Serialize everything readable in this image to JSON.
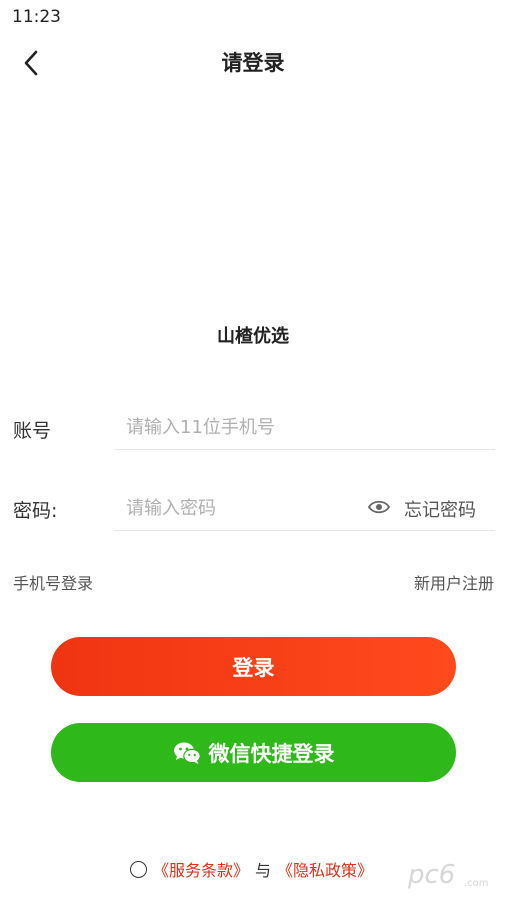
{
  "status_bar": {
    "time": "11:23"
  },
  "header": {
    "title": "请登录"
  },
  "app": {
    "name": "山楂优选"
  },
  "form": {
    "account_label": "账号",
    "account_placeholder": "请输入11位手机号",
    "password_label": "密码:",
    "password_placeholder": "请输入密码",
    "forgot_label": "忘记密码"
  },
  "links": {
    "phone_login": "手机号登录",
    "register": "新用户注册"
  },
  "buttons": {
    "login": "登录",
    "wechat_login": "微信快捷登录"
  },
  "agreement": {
    "terms": "《服务条款》",
    "and": "与",
    "privacy": "《隐私政策》"
  },
  "watermark": {
    "text": "pc6",
    "sub": ".com"
  },
  "colors": {
    "accent": "#f03412",
    "wechat": "#2eb81a",
    "link_red": "#e0321b"
  }
}
